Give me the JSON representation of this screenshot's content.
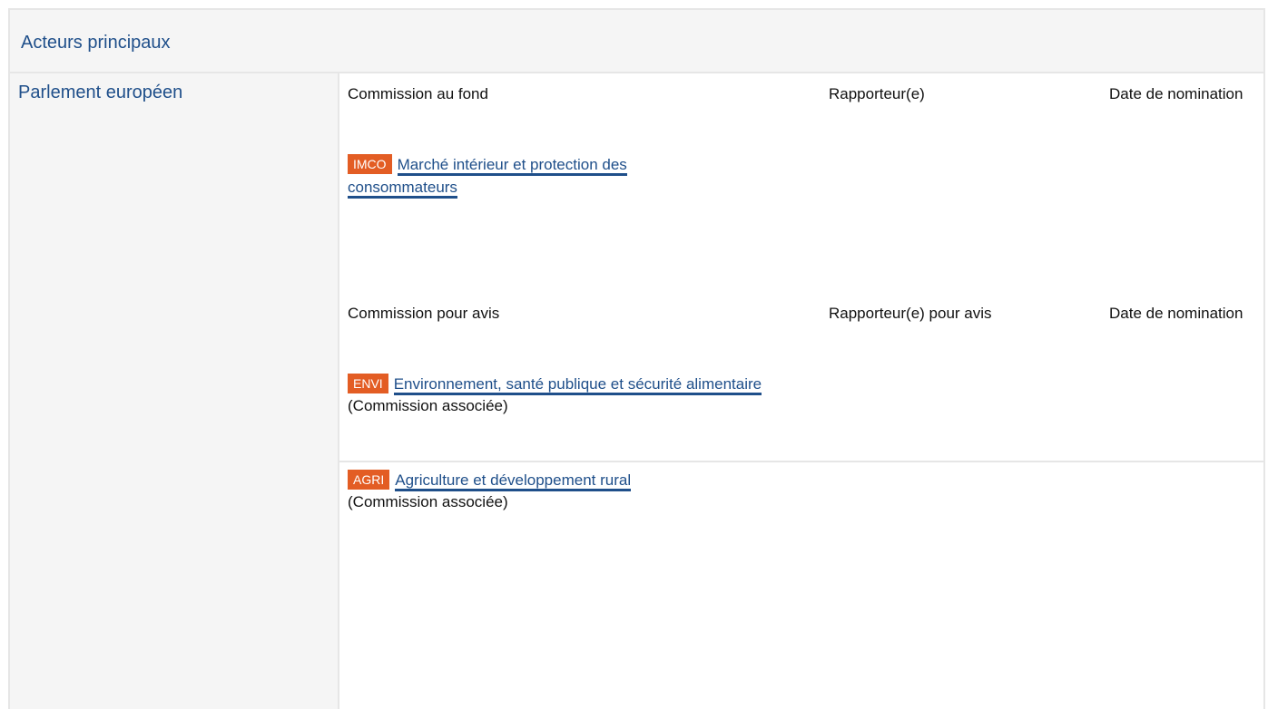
{
  "section": {
    "title": "Acteurs principaux"
  },
  "institution": {
    "name": "Parlement européen"
  },
  "lead": {
    "committee_header": "Commission au fond",
    "rapporteur_header": "Rapporteur(e)",
    "date_header": "Date de nomination",
    "committees": [
      {
        "code": "IMCO",
        "name": "Marché intérieur et protection des consommateurs",
        "note": ""
      }
    ]
  },
  "opinion": {
    "committee_header": "Commission pour avis",
    "rapporteur_header": "Rapporteur(e) pour avis",
    "date_header": "Date de nomination",
    "committees": [
      {
        "code": "ENVI",
        "name": "Environnement, santé publique et sécurité alimentaire",
        "note": "(Commission associée)"
      },
      {
        "code": "AGRI",
        "name": "Agriculture et développement rural",
        "note": "(Commission associée)"
      }
    ]
  },
  "colors": {
    "link": "#1f4f8a",
    "badge": "#e35d24",
    "panel_bg": "#f5f5f5",
    "border": "#e6e6e6"
  }
}
